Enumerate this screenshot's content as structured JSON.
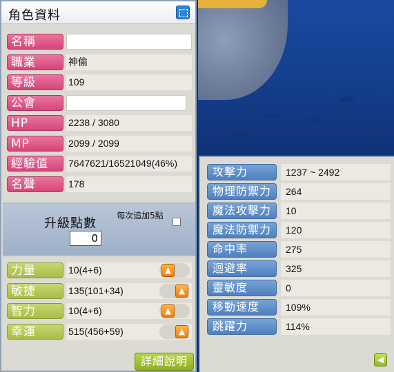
{
  "window": {
    "title": "角色資料"
  },
  "character": {
    "fields": [
      {
        "label": "名稱",
        "value": "",
        "type": "input"
      },
      {
        "label": "職業",
        "value": "神偷",
        "type": "text"
      },
      {
        "label": "等級",
        "value": "109",
        "type": "text"
      },
      {
        "label": "公會",
        "value": "",
        "type": "input"
      },
      {
        "label": "HP",
        "value": "2238 / 3080",
        "type": "text"
      },
      {
        "label": "MP",
        "value": "2099 / 2099",
        "type": "text"
      },
      {
        "label": "經驗值",
        "value": "7647621/16521049(46%)",
        "type": "text"
      },
      {
        "label": "名聲",
        "value": "178",
        "type": "text"
      }
    ]
  },
  "ability_points": {
    "label": "升級點數",
    "value": "0",
    "auto_assign_label": "每次追加5點"
  },
  "stats": [
    {
      "label": "力量",
      "value": "10(4+6)"
    },
    {
      "label": "敏捷",
      "value": "135(101+34)"
    },
    {
      "label": "智力",
      "value": "10(4+6)"
    },
    {
      "label": "幸運",
      "value": "515(456+59)"
    }
  ],
  "detail_button": "詳細說明",
  "detail_stats": [
    {
      "label": "攻擊力",
      "value": "1237 ~ 2492"
    },
    {
      "label": "物理防禦力",
      "value": "264"
    },
    {
      "label": "魔法攻擊力",
      "value": "10"
    },
    {
      "label": "魔法防禦力",
      "value": "120"
    },
    {
      "label": "命中率",
      "value": "275"
    },
    {
      "label": "迴避率",
      "value": "325"
    },
    {
      "label": "靈敏度",
      "value": "0"
    },
    {
      "label": "移動速度",
      "value": "109%"
    },
    {
      "label": "跳躍力",
      "value": "114%"
    }
  ],
  "icons": {
    "title": "minimize-icon",
    "stat_up": "arrow-up-icon",
    "back": "arrow-left-icon"
  },
  "colors": {
    "pink_label": "#d5457a",
    "green_label": "#a8bd48",
    "blue_label": "#4f80be",
    "panel_bg": "#dcdbd3",
    "up_button": "#f07f08"
  }
}
